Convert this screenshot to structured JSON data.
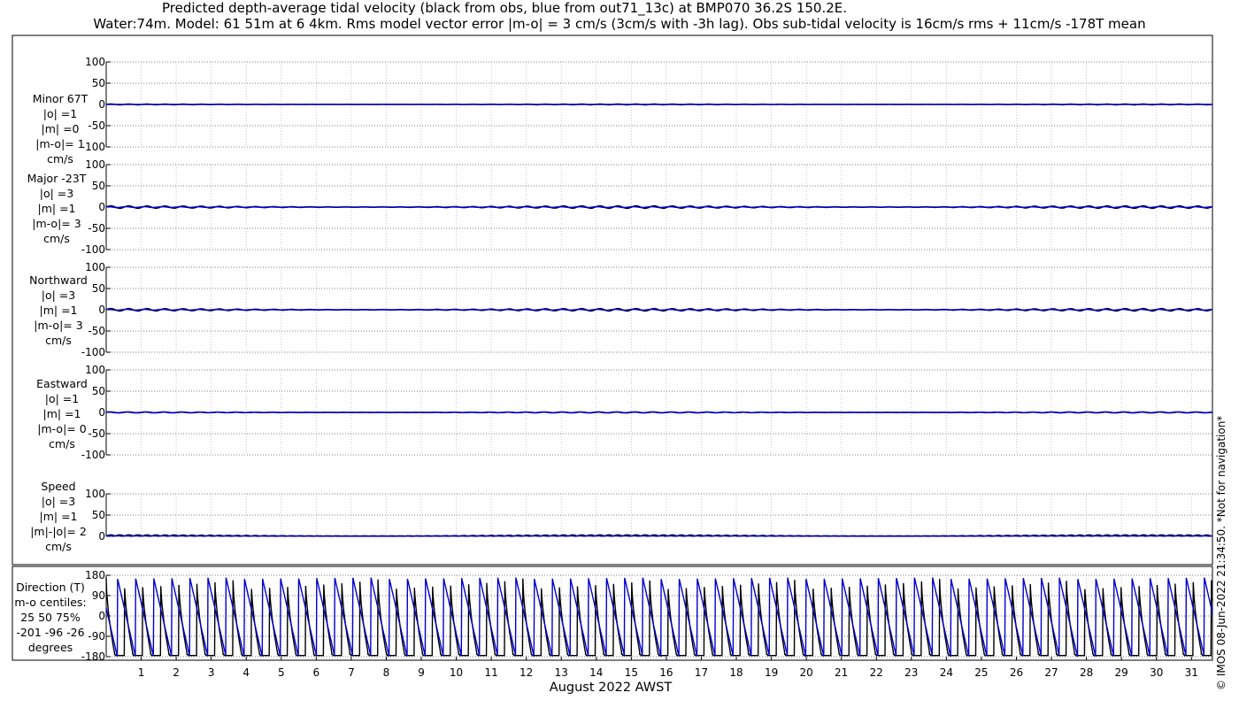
{
  "header": {
    "title_line1": "Predicted depth-average tidal velocity (black from obs, blue from out71_13c) at BMP070 36.2S 150.2E.",
    "title_line2": "Water:74m. Model: 61 51m at 6 4km. Rms model vector error |m-o| = 3 cm/s (3cm/s with -3h lag). Obs sub-tidal velocity is 16cm/s rms + 11cm/s -178T mean"
  },
  "side_note": "© IMOS 08-Jun-2022 21:34:50.  *Not for navigation*",
  "chart_data": {
    "type": "line",
    "xlabel": "August 2022 AWST",
    "x_ticks": [
      "1",
      "2",
      "3",
      "4",
      "5",
      "6",
      "7",
      "8",
      "9",
      "10",
      "11",
      "12",
      "13",
      "14",
      "15",
      "16",
      "17",
      "18",
      "19",
      "20",
      "21",
      "22",
      "23",
      "24",
      "25",
      "26",
      "27",
      "28",
      "29",
      "30",
      "31"
    ],
    "xlim": [
      0,
      31.6
    ],
    "colors": {
      "obs": "#000000",
      "model": "#0000cc"
    },
    "panels": [
      {
        "label_lines": [
          "Minor 67T",
          "|o| =1",
          "|m| =0",
          "|m-o|= 1",
          "cm/s"
        ],
        "ylim": [
          -100,
          100
        ],
        "yticks": [
          "100",
          "50",
          "0",
          "-50",
          "-100"
        ],
        "obs_amp": 1,
        "model_amp": 0
      },
      {
        "label_lines": [
          "Major -23T",
          "|o| =3",
          "|m| =1",
          "|m-o|= 3",
          "cm/s"
        ],
        "ylim": [
          -100,
          100
        ],
        "yticks": [
          "100",
          "50",
          "0",
          "-50",
          "-100"
        ],
        "obs_amp": 3,
        "model_amp": 1
      },
      {
        "label_lines": [
          "Northward",
          "|o| =3",
          "|m| =1",
          "|m-o|= 3",
          "cm/s"
        ],
        "ylim": [
          -100,
          100
        ],
        "yticks": [
          "100",
          "50",
          "0",
          "-50",
          "-100"
        ],
        "obs_amp": 3,
        "model_amp": 1
      },
      {
        "label_lines": [
          "Eastward",
          "|o| =1",
          "|m| =1",
          "|m-o|= 0",
          "cm/s"
        ],
        "ylim": [
          -100,
          100
        ],
        "yticks": [
          "100",
          "50",
          "0",
          "-50",
          "-100"
        ],
        "obs_amp": 1,
        "model_amp": 1
      },
      {
        "label_lines": [
          "Speed",
          "|o| =3",
          "|m| =1",
          "|m|-|o|= 2",
          "cm/s"
        ],
        "ylim": [
          0,
          100
        ],
        "yticks": [
          "100",
          "50",
          "0"
        ],
        "obs_amp": 3,
        "model_amp": 1
      },
      {
        "label_lines": [
          "Direction (T)",
          "m-o centiles:",
          "25  50  75%",
          "-201  -96  -26",
          "degrees"
        ],
        "ylim": [
          -180,
          180
        ],
        "yticks": [
          "180",
          "90",
          "0",
          "-90",
          "-180"
        ]
      }
    ]
  }
}
